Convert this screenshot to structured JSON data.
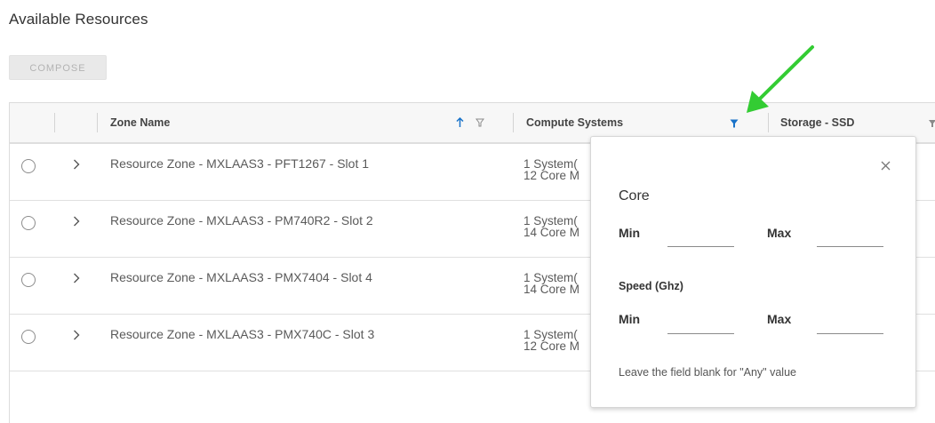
{
  "page": {
    "title": "Available Resources",
    "compose_label": "COMPOSE"
  },
  "grid": {
    "columns": [
      {
        "label": "Zone Name",
        "sorted": "ascending",
        "filter_active": false
      },
      {
        "label": "Compute Systems",
        "filter_active": true
      },
      {
        "label": "Storage - SSD",
        "filter_active": false
      }
    ],
    "rows": [
      {
        "zone_name": "Resource Zone - MXLAAS3 - PFT1267 - Slot 1",
        "compute_line1": "1 System(",
        "compute_line2": "12 Core M"
      },
      {
        "zone_name": "Resource Zone - MXLAAS3 - PM740R2 - Slot 2",
        "compute_line1": "1 System(",
        "compute_line2": "14 Core M"
      },
      {
        "zone_name": "Resource Zone - MXLAAS3 - PMX7404 - Slot 4",
        "compute_line1": "1 System(",
        "compute_line2": "14 Core M"
      },
      {
        "zone_name": "Resource Zone - MXLAAS3 - PMX740C - Slot 3",
        "compute_line1": "1 System(",
        "compute_line2": "12 Core M"
      }
    ]
  },
  "filter_popup": {
    "core_title": "Core",
    "core_min_label": "Min",
    "core_max_label": "Max",
    "core_min_value": "",
    "core_max_value": "",
    "speed_title": "Speed (Ghz)",
    "speed_min_label": "Min",
    "speed_max_label": "Max",
    "speed_min_value": "",
    "speed_max_value": "",
    "hint": "Leave the field blank for \"Any\" value"
  },
  "icons": {
    "sort": "arrow-up-icon",
    "filter": "filter-icon",
    "expand": "chevron-right-icon",
    "close": "close-icon",
    "annotation": "green-arrow"
  },
  "colors": {
    "active_filter": "#1a73c9",
    "sort_arrow": "#1a73c9",
    "annotation_arrow": "#33cc33",
    "inactive_icon": "#8a8a8a"
  }
}
